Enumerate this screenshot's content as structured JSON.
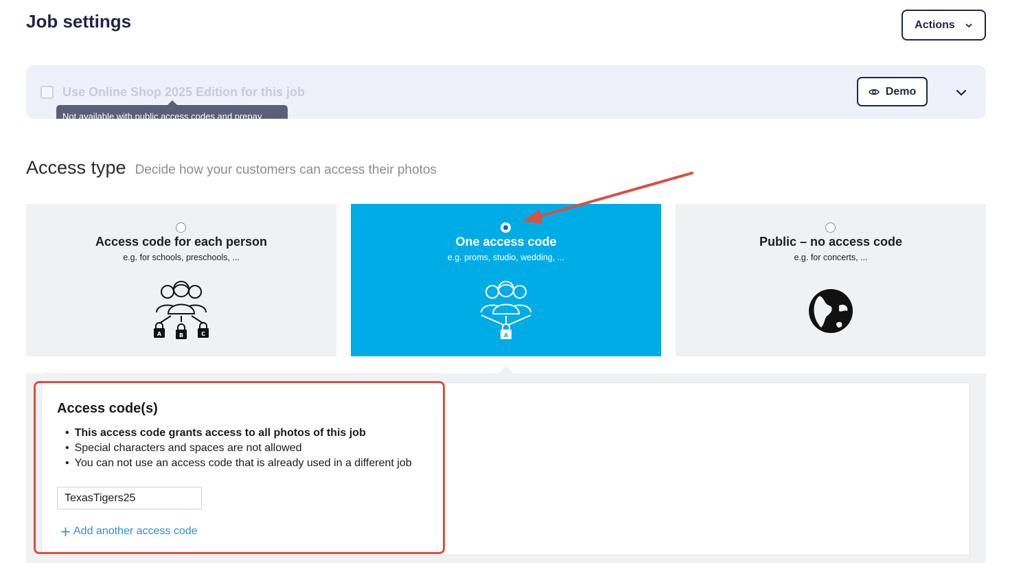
{
  "header": {
    "title": "Job settings",
    "actions_label": "Actions"
  },
  "shop_banner": {
    "checkbox_label": "Use Online Shop 2025 Edition for this job",
    "checked": false,
    "tooltip": "Not available with public access codes and prepay",
    "demo_label": "Demo"
  },
  "access_type": {
    "title": "Access type",
    "subtitle": "Decide how your customers can access their photos",
    "options": [
      {
        "title": "Access code for each person",
        "subtitle": "e.g. for schools, preschools, ...",
        "selected": false,
        "icon": "group-individual-locks-icon"
      },
      {
        "title": "One access code",
        "subtitle": "e.g. proms, studio, wedding, ...",
        "selected": true,
        "icon": "group-single-lock-icon"
      },
      {
        "title": "Public – no access code",
        "subtitle": "e.g. for concerts, ...",
        "selected": false,
        "icon": "globe-icon"
      }
    ]
  },
  "access_codes": {
    "title": "Access code(s)",
    "rules": [
      "This access code grants access to all photos of this job",
      "Special characters and spaces are not allowed",
      "You can not use an access code that is already used in a different job"
    ],
    "code_value": "TexasTigers25",
    "add_label": "Add another access code"
  },
  "colors": {
    "accent": "#00ace6",
    "navy": "#1f2448",
    "annotation": "#d9503f",
    "link": "#2f8fd0"
  }
}
